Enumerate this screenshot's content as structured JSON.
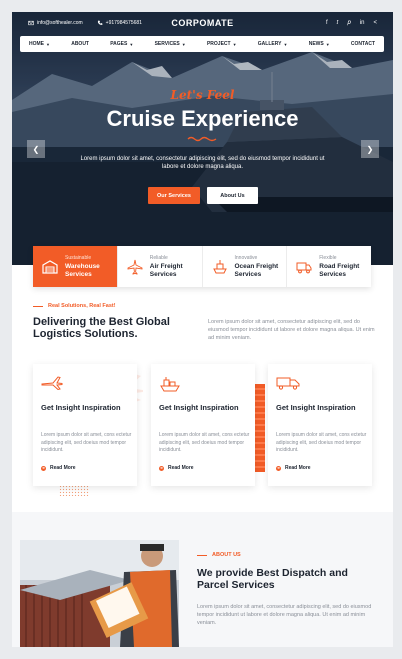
{
  "colors": {
    "accent": "#f25c27",
    "dark": "#1d2430",
    "muted": "#8a8f98"
  },
  "topbar": {
    "email": "info@softhealer.com",
    "phone": "+917984575681",
    "brand": "CORPOMATE",
    "social": [
      "facebook-icon",
      "twitter-icon",
      "pinterest-icon",
      "linkedin-icon",
      "share-icon"
    ]
  },
  "nav": {
    "items": [
      {
        "label": "HOME",
        "dropdown": true
      },
      {
        "label": "ABOUT",
        "dropdown": false
      },
      {
        "label": "PAGES",
        "dropdown": true
      },
      {
        "label": "SERVICES",
        "dropdown": true
      },
      {
        "label": "PROJECT",
        "dropdown": true
      },
      {
        "label": "GALLERY",
        "dropdown": true
      },
      {
        "label": "NEWS",
        "dropdown": true
      },
      {
        "label": "CONTACT",
        "dropdown": false
      }
    ]
  },
  "hero": {
    "subtitle": "Let's Feel",
    "title": "Cruise Experience",
    "description": "Lorem ipsum dolor sit amet, consectetur adipiscing elit, sed do eiusmod tempor incididunt ut labore et dolore magna aliqua.",
    "primary_button": "Our Services",
    "secondary_button": "About Us"
  },
  "services_strip": [
    {
      "small": "Sustainable",
      "line1": "Warehouse",
      "line2": "Services",
      "icon": "warehouse-icon",
      "active": true
    },
    {
      "small": "Reliable",
      "line1": "Air Freight",
      "line2": "Services",
      "icon": "airplane-icon",
      "active": false
    },
    {
      "small": "Innovative",
      "line1": "Ocean Freight",
      "line2": "Services",
      "icon": "ship-icon",
      "active": false
    },
    {
      "small": "Flexible",
      "line1": "Road Freight",
      "line2": "Services",
      "icon": "truck-icon",
      "active": false
    }
  ],
  "intro": {
    "tagline": "Real Solutions, Real Fast!",
    "title": "Delivering the Best Global Logistics Solutions.",
    "description": "Lorem ipsum dolor sit amet, consectetur adipiscing elit, sed do eiusmod tempor incididunt ut labore et dolore magna aliqua. Ut enim ad minim veniam."
  },
  "cards": [
    {
      "icon": "airplane-icon",
      "title": "Get Insight Inspiration",
      "description": "Lorem ipsum dolor sit amet, cons ectetur adipiscing elit, sed doeius mod tempor incididunt.",
      "link": "Read More"
    },
    {
      "icon": "cargo-ship-icon",
      "title": "Get Insight Inspiration",
      "description": "Lorem ipsum dolor sit amet, cons ectetur adipiscing elit, sed doeius mod tempor incididunt.",
      "link": "Read More"
    },
    {
      "icon": "truck-icon",
      "title": "Get Insight Inspiration",
      "description": "Lorem ipsum dolor sit amet, cons ectetur adipiscing elit, sed doeius mod tempor incididunt.",
      "link": "Read More"
    }
  ],
  "about": {
    "tagline": "ABOUT US",
    "title": "We provide Best Dispatch and Parcel Services",
    "description": "Lorem ipsum dolor sit amet, consectetur adipiscing elit, sed do eiusmod tempor incididunt ut labore et dolore magna aliqua. Ut enim ad minim veniam."
  }
}
